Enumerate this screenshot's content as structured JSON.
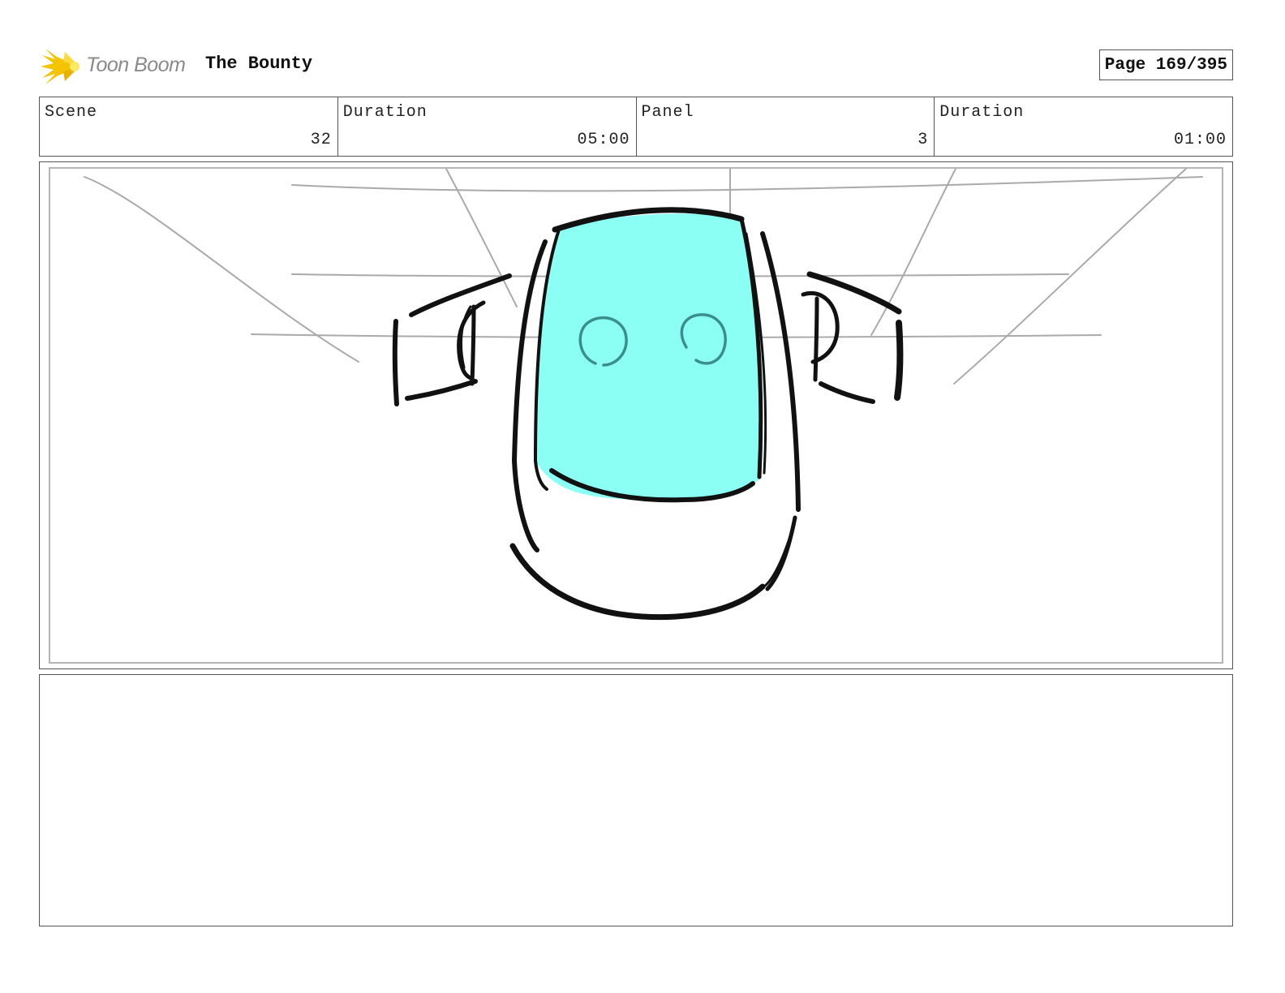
{
  "header": {
    "logo_text": "Toon Boom",
    "project_title": "The Bounty",
    "page_label": "Page 169/395"
  },
  "info": {
    "scene_label": "Scene",
    "scene_value": "32",
    "scene_duration_label": "Duration",
    "scene_duration_value": "05:00",
    "panel_label": "Panel",
    "panel_value": "3",
    "panel_duration_label": "Duration",
    "panel_duration_value": "01:00"
  },
  "colors": {
    "logo_star": "#f5c400",
    "robot_screen": "#8cfff5",
    "robot_eyes": "#3a8f8a",
    "ink": "#111111",
    "guide_lines": "#aaaaaa"
  }
}
